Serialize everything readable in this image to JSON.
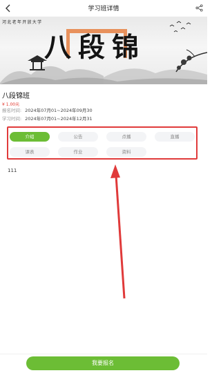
{
  "header": {
    "title": "学习班详情",
    "back_icon": "chevron-left-icon",
    "share_icon": "share-icon"
  },
  "banner": {
    "school_text": "河北老年开放大学",
    "title_art": "八段锦"
  },
  "course": {
    "name": "八段锦班",
    "price": "¥ 1.00元",
    "signup_label": "报名时间:",
    "signup_dates": "2024年07月01~2024年09月30",
    "study_label": "学习时间:",
    "study_dates": "2024年07月01~2024年12月31"
  },
  "tabs": [
    {
      "label": "介绍",
      "active": true
    },
    {
      "label": "公告",
      "active": false
    },
    {
      "label": "点播",
      "active": false
    },
    {
      "label": "直播",
      "active": false
    },
    {
      "label": "课表",
      "active": false
    },
    {
      "label": "作业",
      "active": false
    },
    {
      "label": "资料",
      "active": false
    }
  ],
  "content": {
    "intro_text": "111"
  },
  "footer": {
    "signup_button": "我要报名"
  },
  "colors": {
    "accent_green": "#6cbd35",
    "highlight_red": "#e03a3a",
    "price_red": "#e2362c"
  }
}
